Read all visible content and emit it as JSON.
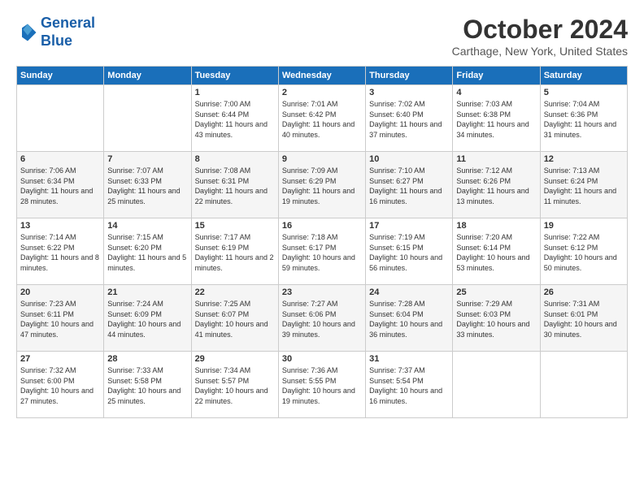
{
  "logo": {
    "line1": "General",
    "line2": "Blue"
  },
  "header": {
    "month": "October 2024",
    "location": "Carthage, New York, United States"
  },
  "weekdays": [
    "Sunday",
    "Monday",
    "Tuesday",
    "Wednesday",
    "Thursday",
    "Friday",
    "Saturday"
  ],
  "weeks": [
    [
      {
        "day": "",
        "info": ""
      },
      {
        "day": "",
        "info": ""
      },
      {
        "day": "1",
        "info": "Sunrise: 7:00 AM\nSunset: 6:44 PM\nDaylight: 11 hours and 43 minutes."
      },
      {
        "day": "2",
        "info": "Sunrise: 7:01 AM\nSunset: 6:42 PM\nDaylight: 11 hours and 40 minutes."
      },
      {
        "day": "3",
        "info": "Sunrise: 7:02 AM\nSunset: 6:40 PM\nDaylight: 11 hours and 37 minutes."
      },
      {
        "day": "4",
        "info": "Sunrise: 7:03 AM\nSunset: 6:38 PM\nDaylight: 11 hours and 34 minutes."
      },
      {
        "day": "5",
        "info": "Sunrise: 7:04 AM\nSunset: 6:36 PM\nDaylight: 11 hours and 31 minutes."
      }
    ],
    [
      {
        "day": "6",
        "info": "Sunrise: 7:06 AM\nSunset: 6:34 PM\nDaylight: 11 hours and 28 minutes."
      },
      {
        "day": "7",
        "info": "Sunrise: 7:07 AM\nSunset: 6:33 PM\nDaylight: 11 hours and 25 minutes."
      },
      {
        "day": "8",
        "info": "Sunrise: 7:08 AM\nSunset: 6:31 PM\nDaylight: 11 hours and 22 minutes."
      },
      {
        "day": "9",
        "info": "Sunrise: 7:09 AM\nSunset: 6:29 PM\nDaylight: 11 hours and 19 minutes."
      },
      {
        "day": "10",
        "info": "Sunrise: 7:10 AM\nSunset: 6:27 PM\nDaylight: 11 hours and 16 minutes."
      },
      {
        "day": "11",
        "info": "Sunrise: 7:12 AM\nSunset: 6:26 PM\nDaylight: 11 hours and 13 minutes."
      },
      {
        "day": "12",
        "info": "Sunrise: 7:13 AM\nSunset: 6:24 PM\nDaylight: 11 hours and 11 minutes."
      }
    ],
    [
      {
        "day": "13",
        "info": "Sunrise: 7:14 AM\nSunset: 6:22 PM\nDaylight: 11 hours and 8 minutes."
      },
      {
        "day": "14",
        "info": "Sunrise: 7:15 AM\nSunset: 6:20 PM\nDaylight: 11 hours and 5 minutes."
      },
      {
        "day": "15",
        "info": "Sunrise: 7:17 AM\nSunset: 6:19 PM\nDaylight: 11 hours and 2 minutes."
      },
      {
        "day": "16",
        "info": "Sunrise: 7:18 AM\nSunset: 6:17 PM\nDaylight: 10 hours and 59 minutes."
      },
      {
        "day": "17",
        "info": "Sunrise: 7:19 AM\nSunset: 6:15 PM\nDaylight: 10 hours and 56 minutes."
      },
      {
        "day": "18",
        "info": "Sunrise: 7:20 AM\nSunset: 6:14 PM\nDaylight: 10 hours and 53 minutes."
      },
      {
        "day": "19",
        "info": "Sunrise: 7:22 AM\nSunset: 6:12 PM\nDaylight: 10 hours and 50 minutes."
      }
    ],
    [
      {
        "day": "20",
        "info": "Sunrise: 7:23 AM\nSunset: 6:11 PM\nDaylight: 10 hours and 47 minutes."
      },
      {
        "day": "21",
        "info": "Sunrise: 7:24 AM\nSunset: 6:09 PM\nDaylight: 10 hours and 44 minutes."
      },
      {
        "day": "22",
        "info": "Sunrise: 7:25 AM\nSunset: 6:07 PM\nDaylight: 10 hours and 41 minutes."
      },
      {
        "day": "23",
        "info": "Sunrise: 7:27 AM\nSunset: 6:06 PM\nDaylight: 10 hours and 39 minutes."
      },
      {
        "day": "24",
        "info": "Sunrise: 7:28 AM\nSunset: 6:04 PM\nDaylight: 10 hours and 36 minutes."
      },
      {
        "day": "25",
        "info": "Sunrise: 7:29 AM\nSunset: 6:03 PM\nDaylight: 10 hours and 33 minutes."
      },
      {
        "day": "26",
        "info": "Sunrise: 7:31 AM\nSunset: 6:01 PM\nDaylight: 10 hours and 30 minutes."
      }
    ],
    [
      {
        "day": "27",
        "info": "Sunrise: 7:32 AM\nSunset: 6:00 PM\nDaylight: 10 hours and 27 minutes."
      },
      {
        "day": "28",
        "info": "Sunrise: 7:33 AM\nSunset: 5:58 PM\nDaylight: 10 hours and 25 minutes."
      },
      {
        "day": "29",
        "info": "Sunrise: 7:34 AM\nSunset: 5:57 PM\nDaylight: 10 hours and 22 minutes."
      },
      {
        "day": "30",
        "info": "Sunrise: 7:36 AM\nSunset: 5:55 PM\nDaylight: 10 hours and 19 minutes."
      },
      {
        "day": "31",
        "info": "Sunrise: 7:37 AM\nSunset: 5:54 PM\nDaylight: 10 hours and 16 minutes."
      },
      {
        "day": "",
        "info": ""
      },
      {
        "day": "",
        "info": ""
      }
    ]
  ]
}
